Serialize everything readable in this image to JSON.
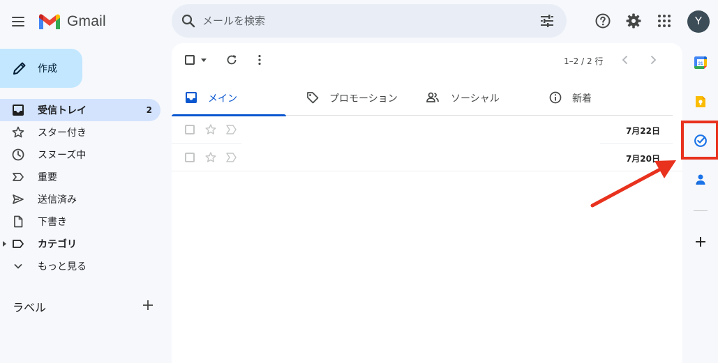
{
  "app": {
    "logo_text": "Gmail"
  },
  "search": {
    "placeholder": "メールを検索"
  },
  "user": {
    "avatar_letter": "Y"
  },
  "compose": {
    "label": "作成"
  },
  "nav": {
    "items": [
      {
        "label": "受信トレイ",
        "count": "2",
        "icon": "inbox-icon"
      },
      {
        "label": "スター付き",
        "icon": "star-icon"
      },
      {
        "label": "スヌーズ中",
        "icon": "clock-icon"
      },
      {
        "label": "重要",
        "icon": "important-icon"
      },
      {
        "label": "送信済み",
        "icon": "send-icon"
      },
      {
        "label": "下書き",
        "icon": "draft-icon"
      },
      {
        "label": "カテゴリ",
        "icon": "label-icon"
      },
      {
        "label": "もっと見る",
        "icon": "chevron-down-icon"
      }
    ],
    "labels_header": "ラベル"
  },
  "toolbar": {
    "pager": "1–2 / 2 行"
  },
  "tabs": [
    {
      "label": "メイン"
    },
    {
      "label": "プロモーション"
    },
    {
      "label": "ソーシャル"
    },
    {
      "label": "新着"
    }
  ],
  "emails": [
    {
      "date": "7月22日"
    },
    {
      "date": "7月20日"
    }
  ],
  "side_panel": {
    "calendar_day": "31"
  },
  "colors": {
    "accent": "#0b57d0",
    "compose_bg": "#c2e7ff",
    "active_nav_bg": "#d3e3fd",
    "annotation_red": "#e8321e"
  }
}
